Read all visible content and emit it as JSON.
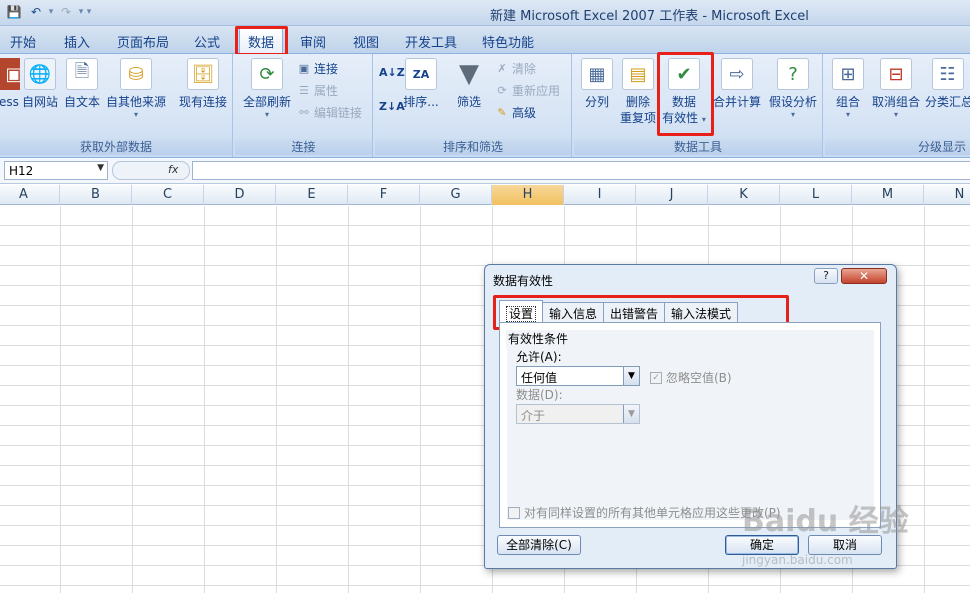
{
  "title_bar": {
    "title": "新建 Microsoft Excel 2007 工作表 - Microsoft Excel"
  },
  "ribbon_tabs": [
    "开始",
    "插入",
    "页面布局",
    "公式",
    "数据",
    "审阅",
    "视图",
    "开发工具",
    "特色功能"
  ],
  "active_tab": "数据",
  "groups": {
    "external": {
      "label": "获取外部数据",
      "access": "ess",
      "web": "自网站",
      "text": "自文本",
      "other": "自其他来源",
      "existing": "现有连接"
    },
    "connections": {
      "label": "连接",
      "refresh_all": "全部刷新",
      "connections": "连接",
      "properties": "属性",
      "edit_links": "编辑链接"
    },
    "sort_filter": {
      "label": "排序和筛选",
      "sort": "排序...",
      "filter": "筛选",
      "clear": "清除",
      "reapply": "重新应用",
      "advanced": "高级"
    },
    "data_tools": {
      "label": "数据工具",
      "split": "分列",
      "remove_dup_1": "删除",
      "remove_dup_2": "重复项",
      "validation_1": "数据",
      "validation_2": "有效性",
      "consolidate": "合并计算",
      "whatif": "假设分析"
    },
    "outline": {
      "label": "分级显示",
      "group": "组合",
      "ungroup": "取消组合",
      "subtotal": "分类汇总"
    }
  },
  "formula_bar": {
    "name_box": "H12",
    "fx": "fx"
  },
  "columns": [
    "A",
    "B",
    "C",
    "D",
    "E",
    "F",
    "G",
    "H",
    "I",
    "J",
    "K",
    "L",
    "M",
    "N"
  ],
  "selected_column": "H",
  "dialog": {
    "title": "数据有效性",
    "help": "?",
    "close": "✕",
    "tabs": [
      "设置",
      "输入信息",
      "出错警告",
      "输入法模式"
    ],
    "active_tab": "设置",
    "fieldset_title": "有效性条件",
    "allow_label": "允许(A):",
    "allow_value": "任何值",
    "ignore_blank": "忽略空值(B)",
    "data_label": "数据(D):",
    "data_value": "介于",
    "apply_all": "对有同样设置的所有其他单元格应用这些更改(P)",
    "clear_all": "全部清除(C)",
    "ok": "确定",
    "cancel": "取消"
  },
  "watermark": {
    "main": "Baidu 经验",
    "sub": "jingyan.baidu.com"
  },
  "colors": {
    "highlight": "#e8201a",
    "ribbon_bg": "#d8e5f5",
    "selected_col": "#f1c15f"
  }
}
